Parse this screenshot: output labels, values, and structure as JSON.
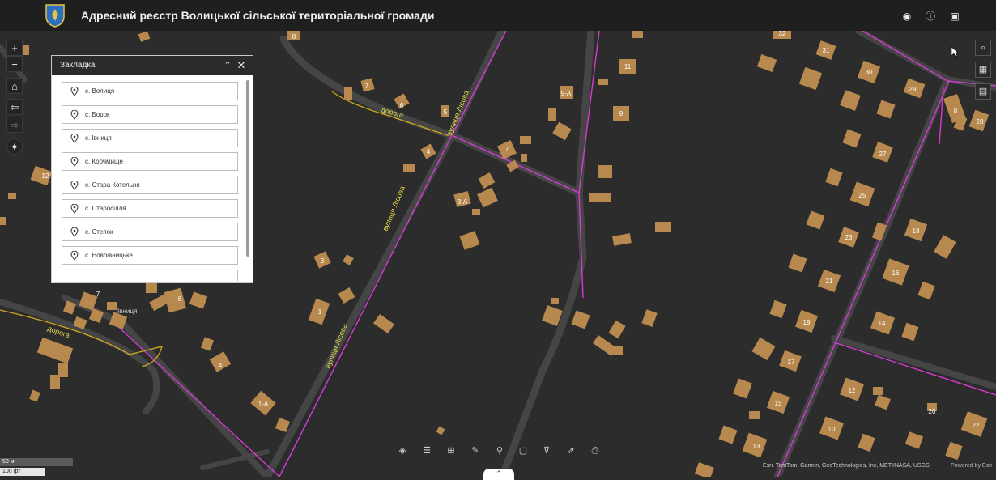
{
  "header": {
    "title": "Адресний реєстр Волицької сільської територіальної громади",
    "logo_icon": "coat-of-arms-icon",
    "icons": [
      "eye-icon",
      "info-icon",
      "user-icon"
    ]
  },
  "left_tools": {
    "zoom_in": "+",
    "zoom_out": "−",
    "home_icon": "home-icon",
    "back_icon": "arrow-left-icon",
    "forward_icon": "arrow-right-icon",
    "compass_icon": "compass-icon"
  },
  "right_tools": [
    "search-icon",
    "qr-code-icon",
    "basemap-icon"
  ],
  "bookmark_panel": {
    "title": "Закладка",
    "collapse_icon": "chevron-up-double-icon",
    "close_icon": "close-icon",
    "items": [
      {
        "label": "с. Волиця"
      },
      {
        "label": "с. Борок"
      },
      {
        "label": "с. Івниця"
      },
      {
        "label": "с. Корчмище"
      },
      {
        "label": "с. Стара Котельня"
      },
      {
        "label": "с. Старосілля"
      },
      {
        "label": "с. Степок"
      },
      {
        "label": "с. Новоівницьке"
      }
    ]
  },
  "map": {
    "streets": [
      {
        "label": "вулиця Лісова"
      },
      {
        "label": "вулиця Лісова"
      },
      {
        "label": "вулиця Лісова"
      },
      {
        "label": "дорога"
      },
      {
        "label": "дорога"
      }
    ],
    "place_label": "Івниця",
    "house_numbers": [
      "8",
      "7",
      "6",
      "5",
      "4",
      "7",
      "12",
      "3",
      "7",
      "6",
      "1",
      "3-А",
      "4",
      "1-А",
      "9-А",
      "11",
      "9",
      "32",
      "31",
      "30",
      "29",
      "8",
      "27",
      "28",
      "25",
      "23",
      "18",
      "21",
      "16",
      "19",
      "14",
      "17",
      "15",
      "12",
      "10",
      "13",
      "20",
      "22"
    ]
  },
  "bottom_toolbar": [
    "layers-icon",
    "legend-icon",
    "table-icon",
    "sketch-icon",
    "query-icon",
    "edit-icon",
    "filter-icon",
    "share-icon",
    "print-icon"
  ],
  "expand_icon": "chevron-up-icon",
  "scale": {
    "metric": "50 м",
    "imperial": "100 фт"
  },
  "attribution": "Esri, TomTom, Garmin, GeoTechnologies, Inc, METI/NASA, USGS",
  "powered_by": "Powered by Esri"
}
